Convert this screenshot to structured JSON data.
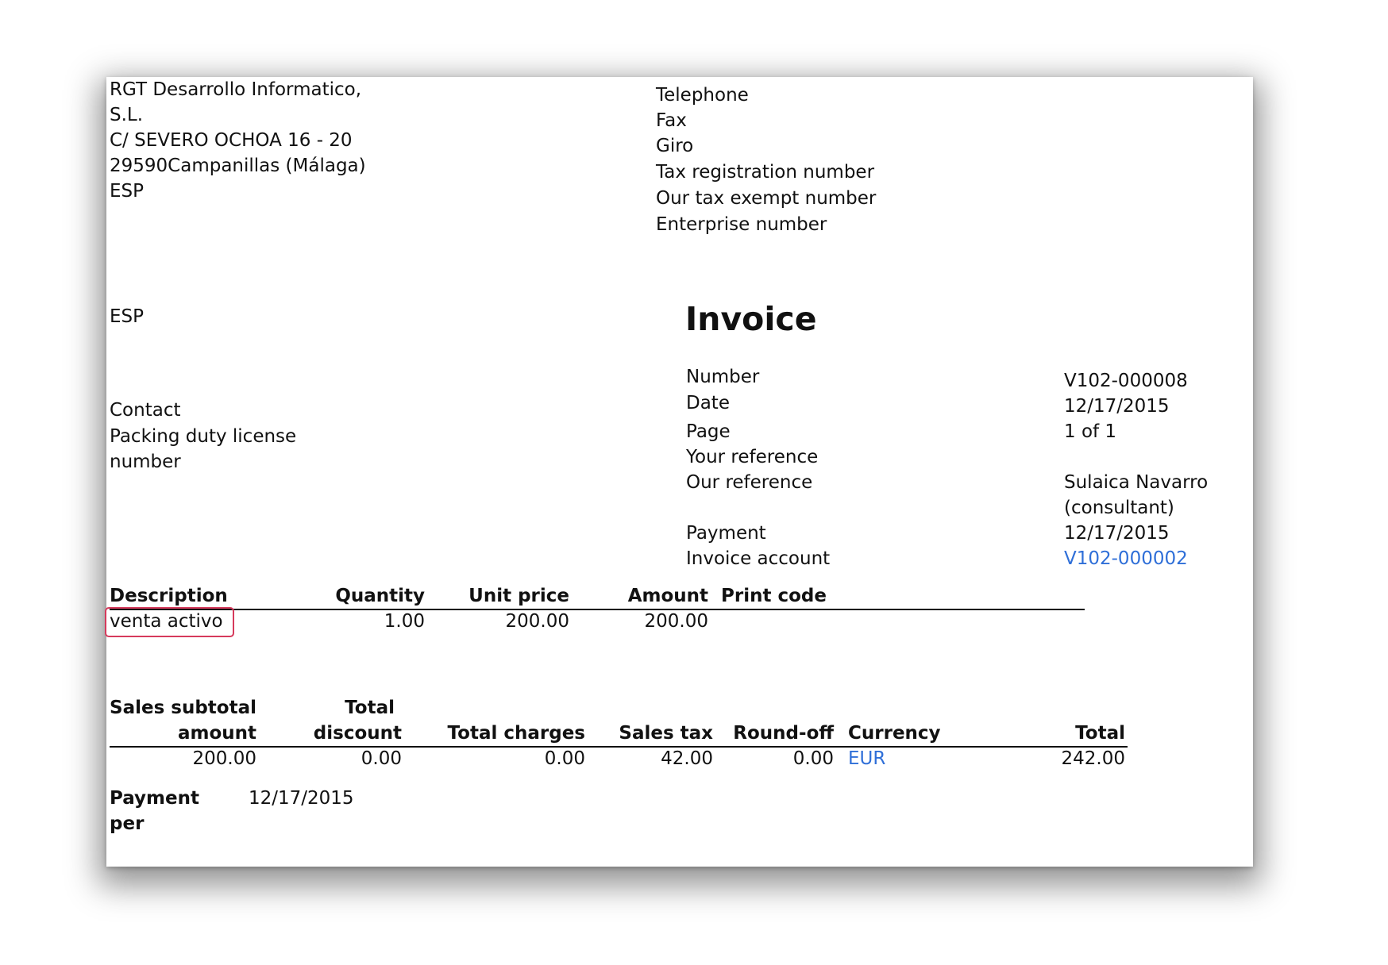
{
  "company": {
    "name_line1": "RGT Desarrollo Informatico,",
    "name_line2": "S.L.",
    "street": "C/ SEVERO OCHOA 16 - 20",
    "city": "29590Campanillas (Málaga)",
    "country": "ESP"
  },
  "company_contact_labels": {
    "telephone": "Telephone",
    "fax": "Fax",
    "giro": "Giro",
    "tax_registration": "Tax registration number",
    "tax_exempt": "Our tax exempt number",
    "enterprise": "Enterprise number"
  },
  "customer": {
    "country": "ESP",
    "contact_label": "Contact",
    "packing_label_line1": "Packing duty license",
    "packing_label_line2": "number"
  },
  "invoice": {
    "title": "Invoice",
    "fields": {
      "number": {
        "label": "Number",
        "value": "V102-000008"
      },
      "date": {
        "label": "Date",
        "value": "12/17/2015"
      },
      "page": {
        "label": "Page",
        "value": "1 of 1"
      },
      "your_reference": {
        "label": "Your reference",
        "value": ""
      },
      "our_reference": {
        "label": "Our reference",
        "value_line1": "Sulaica Navarro",
        "value_line2": "(consultant)"
      },
      "payment": {
        "label": "Payment",
        "value": "12/17/2015"
      },
      "invoice_account": {
        "label": "Invoice account",
        "value": "V102-000002"
      }
    }
  },
  "lines": {
    "headers": {
      "description": "Description",
      "quantity": "Quantity",
      "unit_price": "Unit price",
      "amount": "Amount",
      "print_code": "Print code"
    },
    "rows": [
      {
        "description": "venta activo",
        "quantity": "1.00",
        "unit_price": "200.00",
        "amount": "200.00",
        "print_code": ""
      }
    ]
  },
  "totals": {
    "headers": {
      "sales_subtotal_line1": "Sales subtotal",
      "sales_subtotal_line2": "amount",
      "total_discount_line1": "Total",
      "total_discount_line2": "discount",
      "total_charges": "Total charges",
      "sales_tax": "Sales tax",
      "round_off": "Round-off",
      "currency": "Currency",
      "total": "Total"
    },
    "values": {
      "sales_subtotal": "200.00",
      "total_discount": "0.00",
      "total_charges": "0.00",
      "sales_tax": "42.00",
      "round_off": "0.00",
      "currency": "EUR",
      "total": "242.00"
    }
  },
  "payment_per": {
    "label_line1": "Payment",
    "label_line2": "per",
    "value": "12/17/2015"
  },
  "colors": {
    "link": "#2f6fd8",
    "highlight": "#d63a5c"
  }
}
